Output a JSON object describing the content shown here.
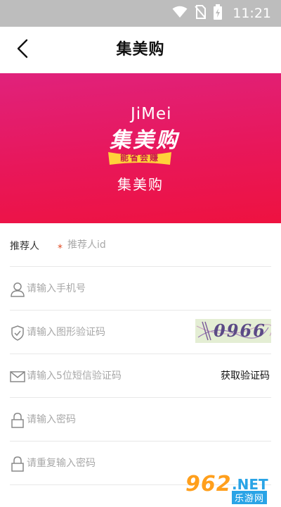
{
  "status_bar": {
    "time": "11:21",
    "icons": [
      "wifi-icon",
      "no-sim-icon",
      "battery-charging-icon"
    ]
  },
  "nav": {
    "back_icon": "chevron-left-icon",
    "title": "集美购"
  },
  "banner": {
    "logo_latin": "JiMei",
    "logo_cn": "集美购",
    "logo_slogan": "能省会赚",
    "app_name": "集美购"
  },
  "form": {
    "referrer": {
      "label": "推荐人",
      "required_mark": "*",
      "placeholder": "推荐人id"
    },
    "phone": {
      "icon": "user-icon",
      "placeholder": "请输入手机号"
    },
    "image_code": {
      "icon": "shield-check-icon",
      "placeholder": "请输入图形验证码",
      "captcha_text": "0966"
    },
    "sms_code": {
      "icon": "envelope-icon",
      "placeholder": "请输入5位短信验证码",
      "button_label": "获取验证码"
    },
    "password": {
      "icon": "lock-icon",
      "placeholder": "请输入密码"
    },
    "password_confirm": {
      "icon": "lock-icon",
      "placeholder": "请重复输入密码"
    }
  },
  "watermark": {
    "digits": "962",
    "suffix": ".NET",
    "cn": "乐游网"
  },
  "colors": {
    "banner_start": "#e0227c",
    "banner_end": "#ee1240",
    "required": "#e04a22",
    "placeholder": "#a8a8a8"
  }
}
